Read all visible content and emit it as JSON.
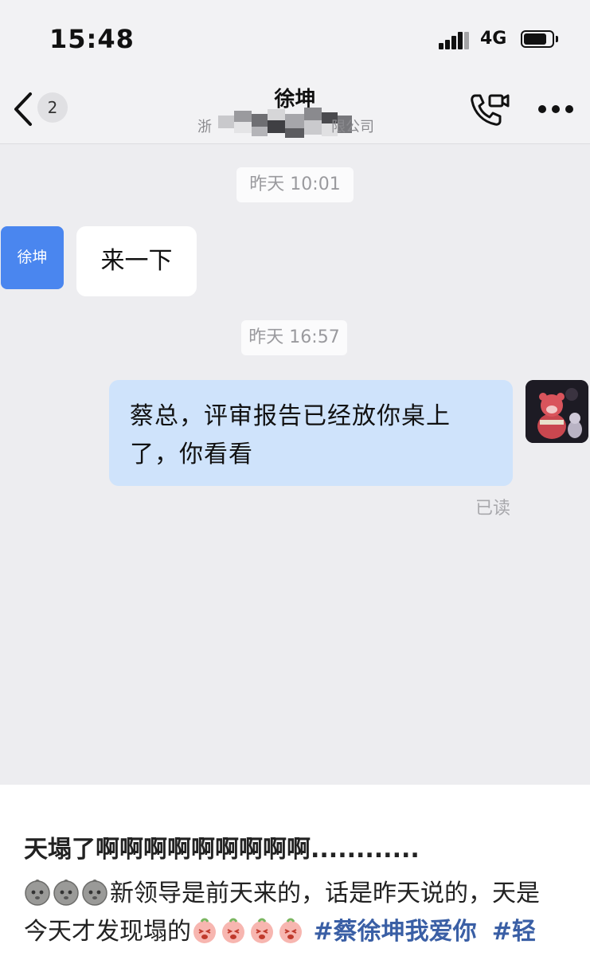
{
  "status_bar": {
    "time": "15:48",
    "network": "4G"
  },
  "nav": {
    "back_count": "2",
    "contact_name": "徐坤",
    "company_prefix": "浙",
    "company_suffix": "限公司"
  },
  "messages": [
    {
      "type": "timestamp",
      "text": "昨天 10:01"
    },
    {
      "type": "incoming",
      "avatar_label": "徐坤",
      "text": "来一下"
    },
    {
      "type": "timestamp",
      "text": "昨天 16:57"
    },
    {
      "type": "outgoing",
      "line1": "蔡总，评审报告已经放你桌上",
      "line2": "了，你看看",
      "status": "已读"
    }
  ],
  "post": {
    "title": "天塌了啊啊啊啊啊啊啊啊啊............",
    "body_part1": "新领导是前天来的，话是昨天说的，天是",
    "body_part2": "今天才发现塌的",
    "tag1": "#蔡徐坤我爱你",
    "tag2": "#轻"
  },
  "icons": {
    "back": "chevron-left-icon",
    "call": "video-call-icon",
    "more": "more-dots-icon",
    "emoji_a": "sad-face-emoji",
    "emoji_b": "crying-peach-emoji"
  },
  "colors": {
    "chat_background": "#ededf0",
    "incoming_avatar": "#4a86ef",
    "outgoing_bubble": "#cfe3fb",
    "hashtag": "#3a5fa5"
  }
}
